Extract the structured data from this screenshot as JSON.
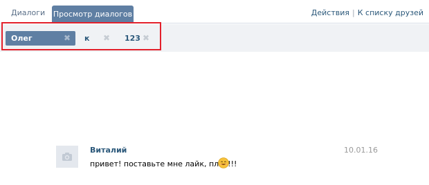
{
  "tabs": {
    "dialogs": "Диалоги",
    "view_dialogs": "Просмотр диалогов"
  },
  "header_actions": {
    "actions": "Действия",
    "separator": "|",
    "friends_list": "К списку друзей"
  },
  "participants": [
    {
      "label": "Олег",
      "active": true
    },
    {
      "label": "к",
      "active": false
    },
    {
      "label": "123",
      "active": false
    }
  ],
  "message": {
    "author": "Виталий",
    "text": "привет! поставьте мне лайк, плиз!!!",
    "date": "10.01.16",
    "emoji": "smile-emoji",
    "avatar_icon": "camera-icon"
  },
  "colors": {
    "active_tab": "#5f7fa3",
    "link": "#2b587a",
    "filter_bg": "#f0f2f5",
    "highlight": "#e3202b"
  }
}
